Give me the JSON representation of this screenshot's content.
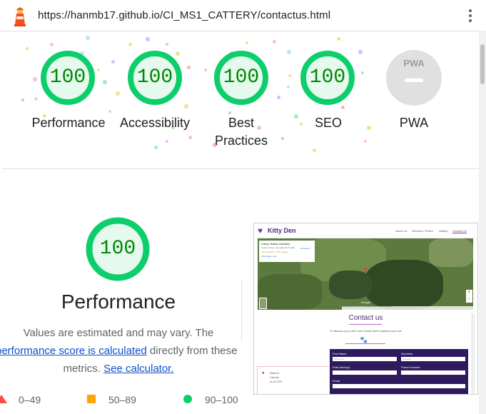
{
  "address_bar": {
    "url": "https://hanmb17.github.io/CI_MS1_CATTERY/contactus.html"
  },
  "categories": [
    {
      "score": "100",
      "label": "Performance"
    },
    {
      "score": "100",
      "label": "Accessibility"
    },
    {
      "score": "100",
      "label": "Best Practices"
    },
    {
      "score": "100",
      "label": "SEO"
    },
    {
      "score": "",
      "label": "PWA",
      "badge": "PWA"
    }
  ],
  "performance": {
    "score": "100",
    "title": "Performance",
    "desc_line1": "Values are estimated and may vary. The",
    "desc_link1": "performance score is calculated",
    "desc_mid": " directly from these",
    "desc_line3_pre": "metrics. ",
    "desc_link2": "See calculator."
  },
  "legend": [
    {
      "range": "0–49",
      "color": "#ff4e42"
    },
    {
      "range": "50–89",
      "color": "#ffa400"
    },
    {
      "range": "90–100",
      "color": "#0cce6b"
    }
  ],
  "colors": {
    "pass": "#0cce6b",
    "pass_text": "#008800",
    "pass_fill": "#e5f9ee"
  },
  "screenshot": {
    "logo": "Kitty Den",
    "nav": [
      "About Us",
      "Services / Prices",
      "Gallery",
      "Contact Us"
    ],
    "map_card_title": "Carey Hollow Gardens",
    "map_card_sub": "Lower Arches, Cornwall, PL13 1EP",
    "map_card_rating": "4.5 ★★★★★ · 135 reviews",
    "map_card_link": "View larger map",
    "map_directions": "Directions",
    "map_footer": "Keyboard shortcuts  Map data ©2022 Google  Terms of Use  Report a map error",
    "map_google": "Google",
    "contact_title": "Contact us",
    "contact_sub": "To discuss your cat's care needs and to pamper your cat",
    "form_labels": [
      "First Name",
      "Surname",
      "Pets Name(s)",
      "Phone Number",
      "Email"
    ],
    "form_placeholders": [
      "First name",
      "Surname",
      "",
      "",
      ""
    ],
    "address_lines": [
      "Warren",
      "Carney",
      "LL22 6TF"
    ]
  }
}
